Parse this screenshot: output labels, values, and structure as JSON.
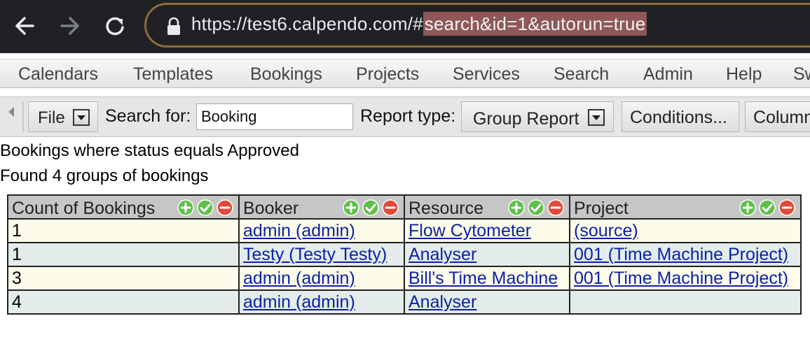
{
  "browser": {
    "url_prefix": "https://test6.calpendo.com/#",
    "url_selected": "search&id=1&autorun=true"
  },
  "menu": {
    "items": [
      "Calendars",
      "Templates",
      "Bookings",
      "Projects",
      "Services",
      "Search",
      "Admin",
      "Help",
      "Sw"
    ]
  },
  "toolbar": {
    "file_label": "File",
    "search_for_label": "Search for:",
    "search_value": "Booking",
    "report_type_label": "Report type:",
    "report_type_value": "Group Report",
    "conditions_label": "Conditions...",
    "columns_label": "Column"
  },
  "report": {
    "criteria_text": "Bookings where status equals Approved",
    "found_text": "Found 4 groups of bookings",
    "columns": [
      "Count of Bookings",
      "Booker",
      "Resource",
      "Project"
    ],
    "rows": [
      [
        "1",
        "admin (admin)",
        "Flow Cytometer",
        "(source)"
      ],
      [
        "1",
        "Testy (Testy Testy)",
        "Analyser",
        "001 (Time Machine Project)"
      ],
      [
        "3",
        "admin (admin)",
        "Bill's Time Machine",
        "001 (Time Machine Project)"
      ],
      [
        "4",
        "admin (admin)",
        "Analyser",
        ""
      ]
    ]
  },
  "colors": {
    "chrome_bg": "#202124",
    "url_highlight": "#8f5757",
    "header_bg": "#c6c6c6",
    "row_odd": "#fdfcea",
    "row_even": "#e3ecea",
    "link": "#0b22a6",
    "add_icon": "#5fbf4a",
    "apply_icon": "#5fbf4a",
    "remove_icon": "#e04a3a"
  },
  "icons": {
    "header_actions": [
      "add-icon",
      "check-icon",
      "remove-icon"
    ]
  }
}
